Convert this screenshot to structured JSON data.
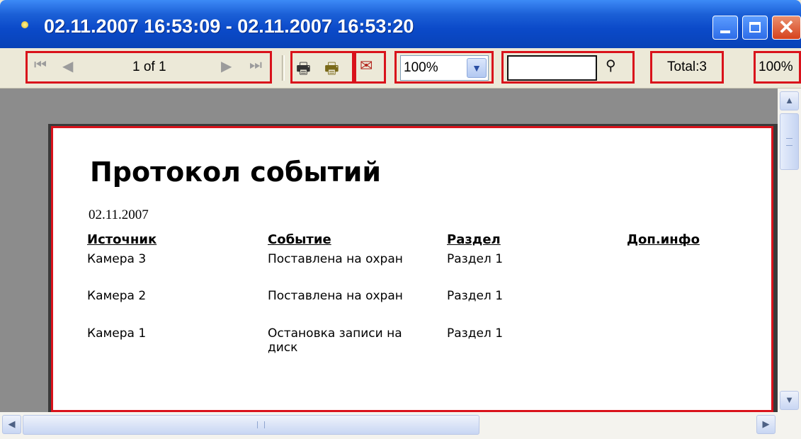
{
  "window": {
    "title": "02.11.2007 16:53:09 - 02.11.2007 16:53:20",
    "close_glyph": "✕"
  },
  "toolbar": {
    "first_icon": "first-page-icon",
    "prev_icon": "prev-page-icon",
    "page_indicator": "1 of 1",
    "next_icon": "next-page-icon",
    "last_icon": "last-page-icon",
    "print_icon": "printer-icon",
    "print_setup_icon": "printer-setup-icon",
    "export_icon": "export-icon",
    "zoom_value": "100%",
    "search_value": "",
    "find_icon": "binoculars-icon",
    "total": "Total:3",
    "zoom_percent": "100%"
  },
  "report": {
    "title": "Протокол событий",
    "date": "02.11.2007",
    "columns": [
      "Источник",
      "Событие",
      "Раздел",
      "Доп.инфо"
    ],
    "rows": [
      {
        "source": "Камера 3",
        "event": "Поставлена на охран",
        "section": "Раздел 1",
        "info": ""
      },
      {
        "source": "Камера 2",
        "event": "Поставлена на охран",
        "section": "Раздел 1",
        "info": ""
      },
      {
        "source": "Камера 1",
        "event": "Остановка записи на диск",
        "section": "Раздел 1",
        "info": ""
      }
    ]
  },
  "colors": {
    "titlebar": "#0b4ac9",
    "highlight": "#d9121b",
    "workspace": "#8c8c8c"
  }
}
